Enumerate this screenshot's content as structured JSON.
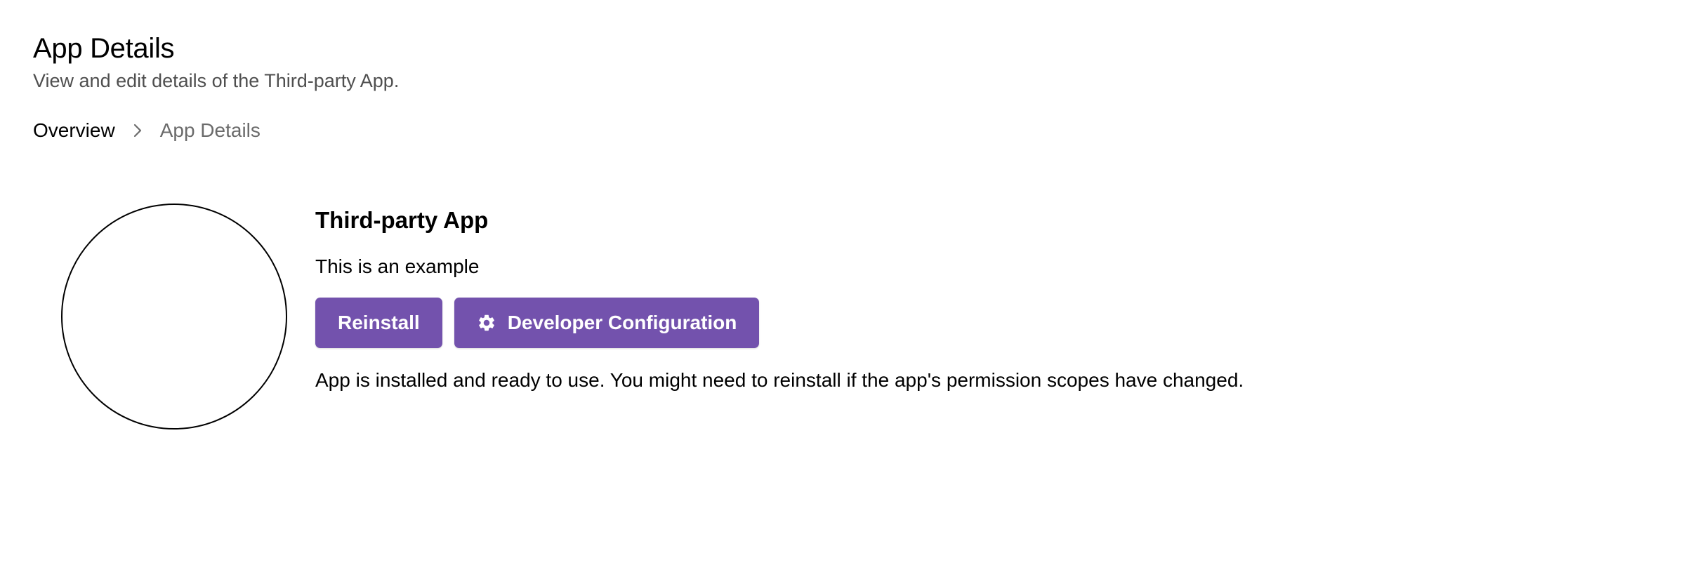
{
  "header": {
    "title": "App Details",
    "subtitle": "View and edit details of the Third-party App."
  },
  "breadcrumb": {
    "items": [
      "Overview",
      "App Details"
    ],
    "separator_icon": "chevron-right-icon"
  },
  "app": {
    "name": "Third-party App",
    "description": "This is an example",
    "status_message": "App is installed and ready to use. You might need to reinstall if the app's permission scopes have changed."
  },
  "actions": {
    "reinstall_label": "Reinstall",
    "developer_config_label": "Developer Configuration",
    "developer_config_icon": "gear-icon"
  },
  "colors": {
    "primary_button": "#7352ad",
    "button_text": "#ffffff",
    "subtitle_text": "#4f4f4f",
    "breadcrumb_current": "#6b6b6b"
  }
}
